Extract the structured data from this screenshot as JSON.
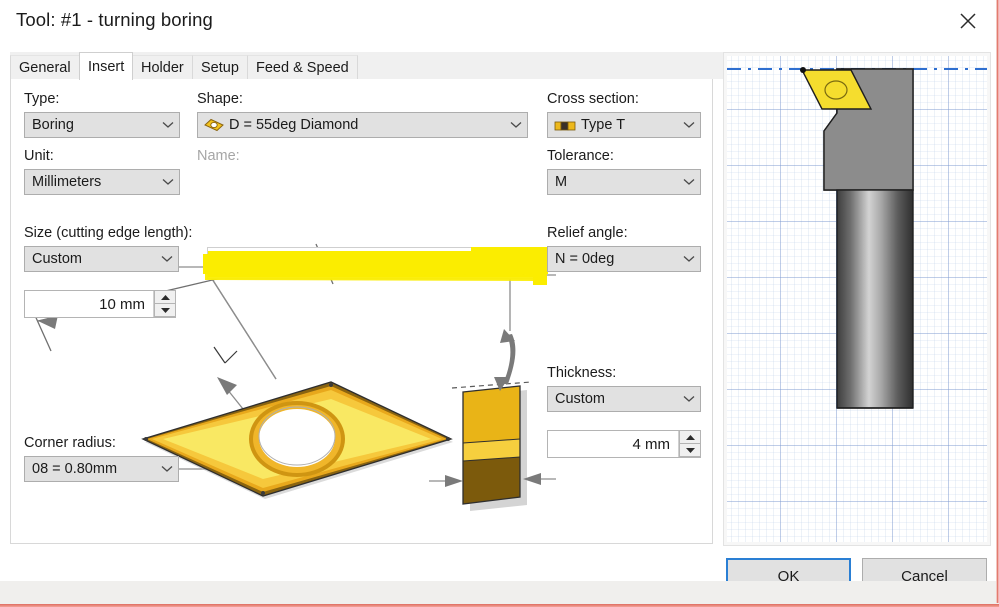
{
  "window": {
    "title": "Tool: #1 - turning boring",
    "close_icon": "close-icon"
  },
  "tabs": [
    {
      "label": "General",
      "active": false
    },
    {
      "label": "Insert",
      "active": true
    },
    {
      "label": "Holder",
      "active": false
    },
    {
      "label": "Setup",
      "active": false
    },
    {
      "label": "Feed & Speed",
      "active": false
    }
  ],
  "form": {
    "type": {
      "label": "Type:",
      "value": "Boring"
    },
    "unit": {
      "label": "Unit:",
      "value": "Millimeters"
    },
    "shape": {
      "label": "Shape:",
      "value": "D = 55deg Diamond",
      "icon": "diamond-insert-icon"
    },
    "name": {
      "label": "Name:",
      "value": "",
      "redacted": true
    },
    "cross_section": {
      "label": "Cross section:",
      "value": "Type T",
      "icon": "cross-section-t-icon"
    },
    "tolerance": {
      "label": "Tolerance:",
      "value": "M"
    },
    "size": {
      "label": "Size (cutting edge length):",
      "value": "Custom",
      "amount": "10 mm"
    },
    "corner_radius": {
      "label": "Corner radius:",
      "value": "08 = 0.80mm"
    },
    "relief_angle": {
      "label": "Relief angle:",
      "value": "N = 0deg"
    },
    "thickness": {
      "label": "Thickness:",
      "value": "Custom",
      "amount": "4 mm"
    }
  },
  "buttons": {
    "ok": "OK",
    "cancel": "Cancel"
  },
  "colors": {
    "insert_face": "#f7e64e",
    "insert_rim": "#e0a81e",
    "insert_rim_dark": "#8a6410",
    "accent_blue": "#2a7fd4",
    "redaction_yellow": "#fbed00",
    "tool_body_gray": "#8c8c8c",
    "grid_blue": "#aebfe0"
  }
}
